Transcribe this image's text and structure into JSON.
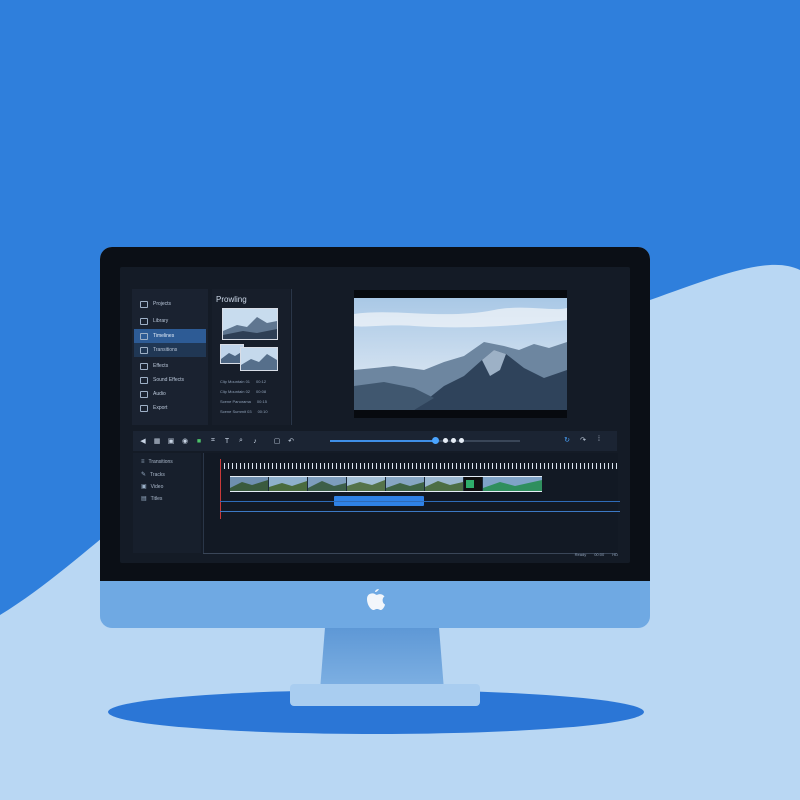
{
  "colors": {
    "background": "#2f7fdc",
    "hill": "#b9d7f3",
    "screen_bg": "#141b26",
    "accent": "#2f82e6",
    "active_item": "#2d5b95"
  },
  "sidebar": {
    "items": [
      {
        "label": "Projects",
        "icon": "folder-icon"
      },
      {
        "label": "Library",
        "icon": "library-icon"
      },
      {
        "label": "Timelines",
        "icon": "timeline-icon",
        "state": "active"
      },
      {
        "label": "Transitions",
        "icon": "transition-icon",
        "state": "selected"
      },
      {
        "label": "Effects",
        "icon": "effects-icon"
      },
      {
        "label": "Sound Effects",
        "icon": "sound-icon"
      },
      {
        "label": "Audio",
        "icon": "audio-icon"
      },
      {
        "label": "Export",
        "icon": "export-icon"
      }
    ]
  },
  "media": {
    "title": "Prowling",
    "rows": [
      {
        "name": "Clip Mountain 01",
        "duration": "00:12"
      },
      {
        "name": "Clip Mountain 02",
        "duration": "00:08"
      },
      {
        "name": "Scene Panorama",
        "duration": "00:15"
      },
      {
        "name": "Scene Summit 03",
        "duration": "00:10"
      }
    ]
  },
  "toolbar": {
    "tools": [
      {
        "icon": "back-icon",
        "glyph": "◀"
      },
      {
        "icon": "grid-icon",
        "glyph": "▦"
      },
      {
        "icon": "layers-icon",
        "glyph": "▣"
      },
      {
        "icon": "color-icon",
        "glyph": "◉"
      },
      {
        "icon": "green-media-icon",
        "glyph": "■"
      },
      {
        "icon": "crop-icon",
        "glyph": "⌗"
      },
      {
        "icon": "text-icon",
        "glyph": "T"
      },
      {
        "icon": "search-icon",
        "glyph": "⌕"
      },
      {
        "icon": "audio-icon",
        "glyph": "♪"
      },
      {
        "icon": "comment-icon",
        "glyph": "▢"
      },
      {
        "icon": "undo-icon",
        "glyph": "↶"
      }
    ],
    "scrub_progress": 0.55,
    "right_icons": [
      {
        "icon": "refresh-icon",
        "glyph": "↻"
      },
      {
        "icon": "redo-icon",
        "glyph": "↷"
      },
      {
        "icon": "settings-icon",
        "glyph": "⁞"
      }
    ]
  },
  "tracks": [
    {
      "label": "Transitions",
      "icon": "transition-track-icon",
      "glyph": "≡"
    },
    {
      "label": "Tracks",
      "icon": "pen-track-icon",
      "glyph": "✎"
    },
    {
      "label": "Video",
      "icon": "video-track-icon",
      "glyph": "▣"
    },
    {
      "label": "Titles",
      "icon": "title-track-icon",
      "glyph": "▤"
    }
  ],
  "status": {
    "items": [
      "Ready",
      "00:00",
      "HD"
    ]
  }
}
